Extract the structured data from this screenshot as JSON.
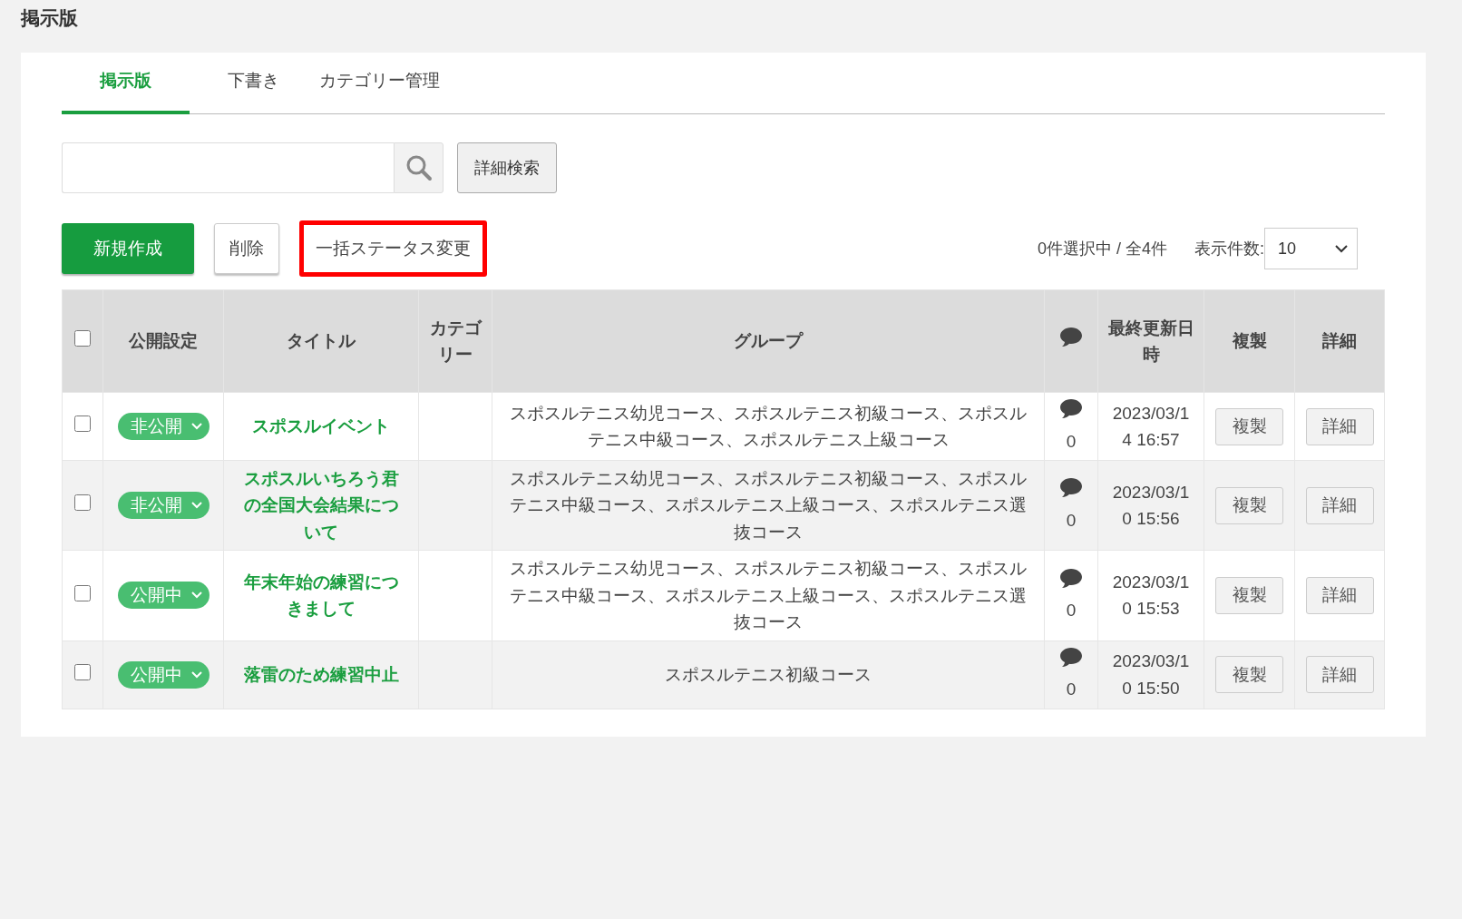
{
  "page_title": "掲示版",
  "tabs": [
    {
      "label": "掲示版",
      "selected": true
    },
    {
      "label": "下書き",
      "selected": false
    },
    {
      "label": "カテゴリー管理",
      "selected": false
    }
  ],
  "search": {
    "advanced_button": "詳細検索"
  },
  "actions": [
    {
      "label": "新規作成",
      "kind": "primary",
      "highlighted": false
    },
    {
      "label": "削除",
      "kind": "default",
      "highlighted": false
    },
    {
      "label": "一括ステータス変更",
      "kind": "plain",
      "highlighted": true
    }
  ],
  "selection_summary": "0件選択中 / 全4件",
  "per_page": {
    "label": "表示件数:",
    "value": "10"
  },
  "table": {
    "select_all_checked": false,
    "columns": [
      {
        "label": "公開設定"
      },
      {
        "label": "タイトル"
      },
      {
        "label": "カテゴリー"
      },
      {
        "label": "グループ"
      },
      {
        "label": "最終更新日時"
      },
      {
        "label": "複製"
      },
      {
        "label": "詳細"
      }
    ],
    "rows": [
      {
        "checked": false,
        "status": "非公開",
        "title": "スポスルイベント",
        "group": "スポスルテニス幼児コース、スポスルテニス初級コース、スポスルテニス中級コース、スポスルテニス上級コース",
        "comments": "0",
        "updated": "2023/03/14 16:57",
        "copy_button": "複製",
        "detail_button": "詳細"
      },
      {
        "checked": false,
        "status": "非公開",
        "title": "スポスルいちろう君の全国大会結果について",
        "group": "スポスルテニス幼児コース、スポスルテニス初級コース、スポスルテニス中級コース、スポスルテニス上級コース、スポスルテニス選抜コース",
        "comments": "0",
        "updated": "2023/03/10 15:56",
        "copy_button": "複製",
        "detail_button": "詳細"
      },
      {
        "checked": false,
        "status": "公開中",
        "title": "年末年始の練習につきまして",
        "group": "スポスルテニス幼児コース、スポスルテニス初級コース、スポスルテニス中級コース、スポスルテニス上級コース、スポスルテニス選抜コース",
        "comments": "0",
        "updated": "2023/03/10 15:53",
        "copy_button": "複製",
        "detail_button": "詳細"
      },
      {
        "checked": false,
        "status": "公開中",
        "title": "落雷のため練習中止",
        "group": "スポスルテニス初級コース",
        "comments": "0",
        "updated": "2023/03/10 15:50",
        "copy_button": "複製",
        "detail_button": "詳細"
      }
    ]
  }
}
